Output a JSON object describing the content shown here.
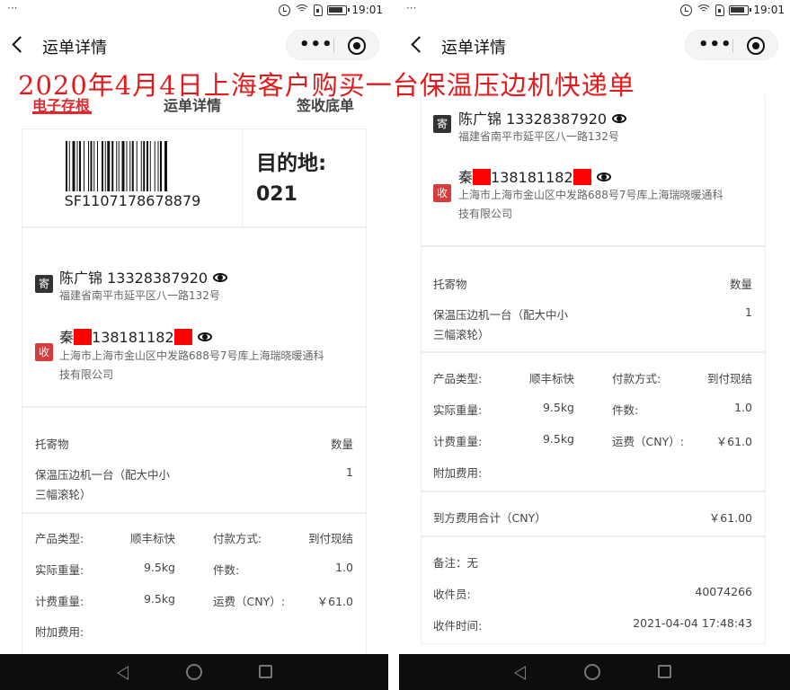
{
  "headline": "2020年4月4日上海客户购买一台保温压边机快递单",
  "status_bar": {
    "left_dots": "···",
    "time": "19:01"
  },
  "nav": {
    "title": "运单详情",
    "more": "•••"
  },
  "tabs": [
    "电子存根",
    "运单详情",
    "签收底单"
  ],
  "waybill": {
    "number": "SF1107178678879",
    "destination_label": "目的地:",
    "destination_code": "021"
  },
  "sender": {
    "tag": "寄",
    "name_phone": "陈广锦 13328387920",
    "address": "福建省南平市延平区八一路132号"
  },
  "receiver": {
    "tag": "收",
    "name_prefix": "秦",
    "phone_partial": "138181182",
    "address_line1": "上海市上海市金山区中发路688号7号库上海瑞晓暖通科",
    "address_line2": "技有限公司"
  },
  "goods": {
    "header_item": "托寄物",
    "header_qty": "数量",
    "item_line1": "保温压边机一台（配大中小",
    "item_line2": "三幅滚轮）",
    "qty": "1"
  },
  "fees": {
    "product_type_label": "产品类型:",
    "product_type": "顺丰标快",
    "payment_label": "付款方式:",
    "payment": "到付现结",
    "actual_weight_label": "实际重量:",
    "actual_weight": "9.5kg",
    "pieces_label": "件数:",
    "pieces": "1.0",
    "billing_weight_label": "计费重量:",
    "billing_weight": "9.5kg",
    "freight_label": "运费（CNY）:",
    "freight": "￥61.0",
    "extra_label": "附加费用:"
  },
  "summary": {
    "total_label": "到方费用合计（CNY）",
    "total": "￥61.00",
    "remark": "备注：无",
    "courier_label": "收件员:",
    "courier": "40074266",
    "time_label": "收件时间:",
    "time": "2021-04-04 17:48:43"
  }
}
